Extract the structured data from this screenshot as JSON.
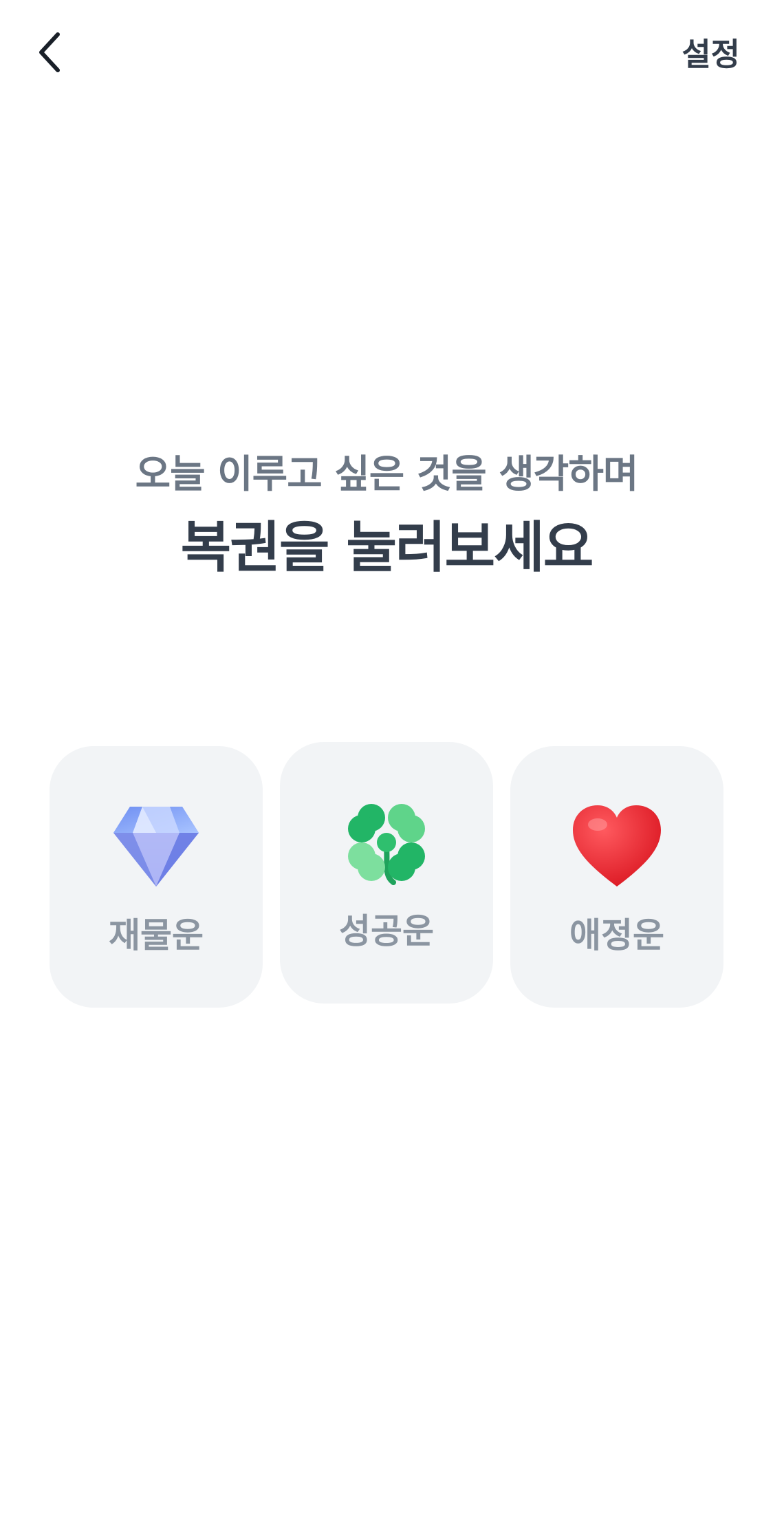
{
  "header": {
    "back_icon": "chevron-left-icon",
    "settings_label": "설정"
  },
  "prompt": {
    "subtitle": "오늘 이루고 싶은 것을 생각하며",
    "title": "복권을 눌러보세요"
  },
  "cards": [
    {
      "label": "재물운",
      "icon": "gem-icon"
    },
    {
      "label": "성공운",
      "icon": "four-leaf-clover-icon"
    },
    {
      "label": "애정운",
      "icon": "heart-icon"
    }
  ],
  "colors": {
    "text_primary": "#333d4b",
    "text_secondary": "#6b7684",
    "card_label": "#8b95a1",
    "card_background": "#f2f4f6"
  }
}
